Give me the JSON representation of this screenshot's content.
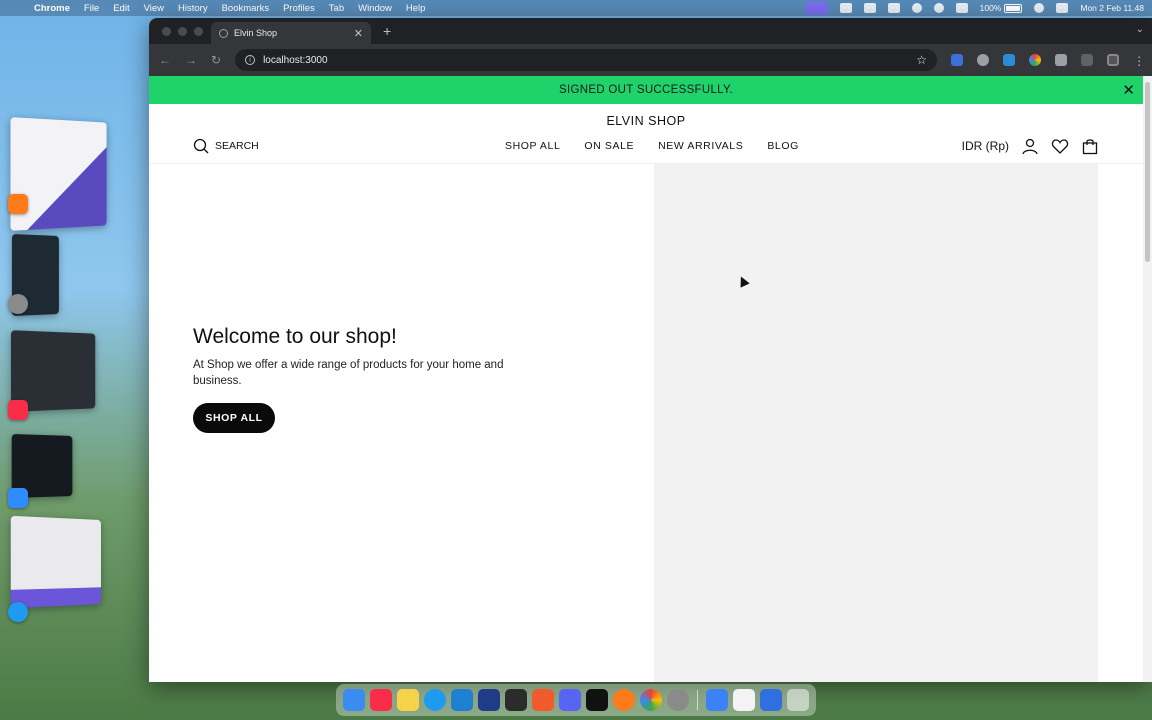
{
  "menubar": {
    "app_name": "Chrome",
    "items": [
      "File",
      "Edit",
      "View",
      "History",
      "Bookmarks",
      "Profiles",
      "Tab",
      "Window",
      "Help"
    ],
    "battery": "100%",
    "datetime": "Mon 2 Feb  11.48"
  },
  "browser": {
    "tab_title": "Elvin Shop",
    "url": "localhost:3000"
  },
  "page": {
    "banner": "SIGNED OUT SUCCESSFULLY.",
    "brand": "ELVIN SHOP",
    "search_label": "SEARCH",
    "nav": [
      "SHOP ALL",
      "ON SALE",
      "NEW ARRIVALS",
      "BLOG"
    ],
    "currency": "IDR (Rp)",
    "hero_title": "Welcome to our shop!",
    "hero_text": "At Shop we offer a wide range of products for your home and business.",
    "hero_button": "SHOP ALL"
  },
  "colors": {
    "banner": "#1fd36a",
    "button": "#0a0a0a",
    "hero_panel": "#f2f2f2"
  }
}
